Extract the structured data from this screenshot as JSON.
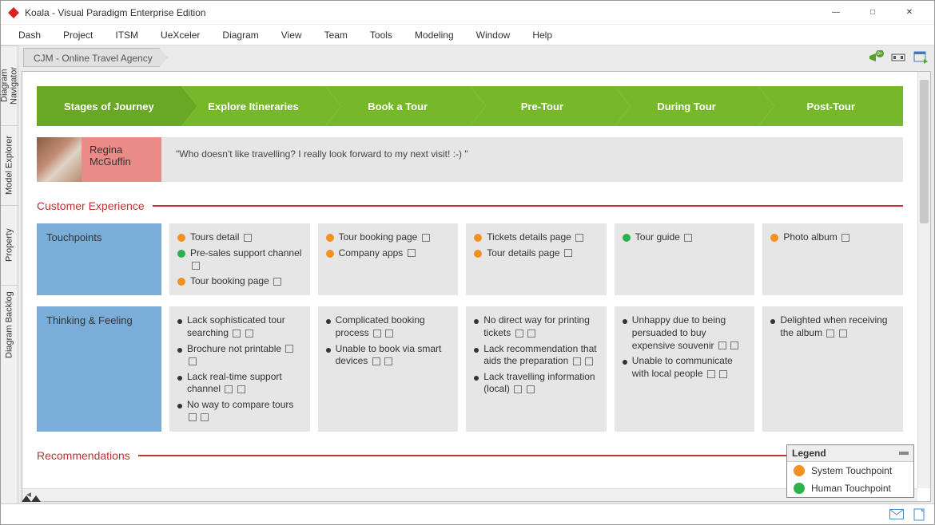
{
  "window": {
    "title": "Koala - Visual Paradigm Enterprise Edition"
  },
  "menu": [
    "Dash",
    "Project",
    "ITSM",
    "UeXceler",
    "Diagram",
    "View",
    "Team",
    "Tools",
    "Modeling",
    "Window",
    "Help"
  ],
  "breadcrumb": "CJM - Online Travel Agency",
  "side_tabs": [
    "Diagram Navigator",
    "Model Explorer",
    "Property",
    "Diagram Backlog"
  ],
  "stages": [
    "Stages of Journey",
    "Explore Itineraries",
    "Book a Tour",
    "Pre-Tour",
    "During Tour",
    "Post-Tour"
  ],
  "persona": {
    "name": "Regina McGuffin"
  },
  "quote": "\"Who doesn't like travelling? I really look forward to my next visit! :-) \"",
  "sections": {
    "cx": "Customer Experience",
    "rec": "Recommendations"
  },
  "lanes": {
    "touchpoints": {
      "label": "Touchpoints",
      "cols": [
        [
          {
            "c": "orange",
            "t": "Tours detail"
          },
          {
            "c": "green",
            "t": "Pre-sales support channel"
          },
          {
            "c": "orange",
            "t": "Tour booking page"
          }
        ],
        [
          {
            "c": "orange",
            "t": "Tour booking page"
          },
          {
            "c": "orange",
            "t": "Company apps"
          }
        ],
        [
          {
            "c": "orange",
            "t": "Tickets details page"
          },
          {
            "c": "orange",
            "t": "Tour details page"
          }
        ],
        [
          {
            "c": "green",
            "t": "Tour guide"
          }
        ],
        [
          {
            "c": "orange",
            "t": "Photo album"
          }
        ]
      ]
    },
    "thinking": {
      "label": "Thinking & Feeling",
      "cols": [
        [
          "Lack sophisticated tour searching",
          "Brochure not printable",
          "Lack real-time support channel",
          "No way to compare tours"
        ],
        [
          "Complicated booking process",
          "Unable to book via smart devices"
        ],
        [
          "No direct way for printing tickets",
          "Lack recommendation that aids the preparation",
          "Lack travelling information (local)"
        ],
        [
          "Unhappy due to being persuaded to buy expensive souvenir",
          "Unable to communicate with local people"
        ],
        [
          "Delighted when receiving the album"
        ]
      ]
    }
  },
  "legend": {
    "title": "Legend",
    "items": [
      {
        "c": "#f39020",
        "t": "System Touchpoint"
      },
      {
        "c": "#2bb24c",
        "t": "Human Touchpoint"
      }
    ]
  }
}
